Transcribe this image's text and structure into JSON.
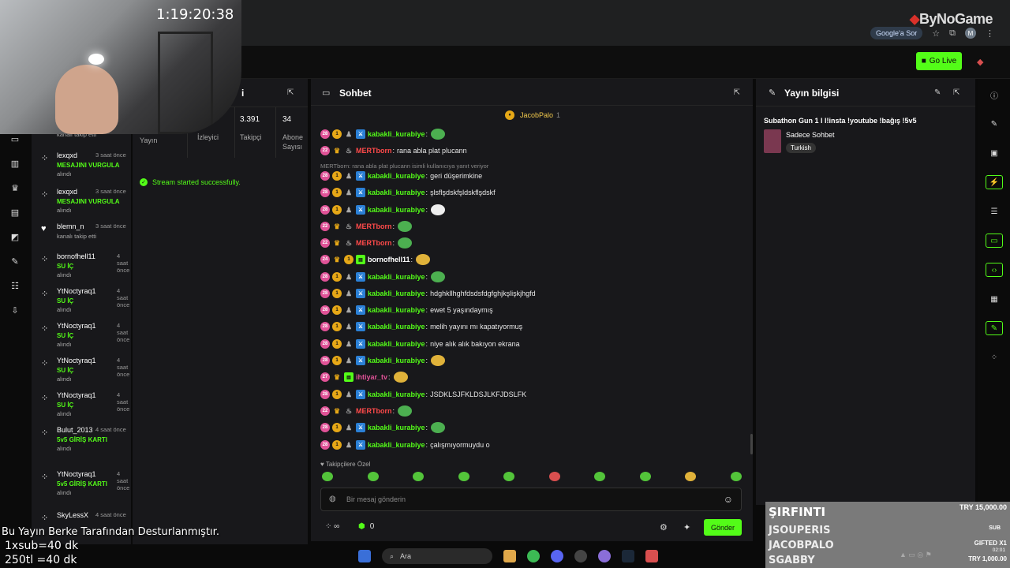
{
  "overlay": {
    "timer": "1:19:20:38",
    "brand": "ByNoGame",
    "footer_line1": "Bu Yayın Berke Tarafından Desturlanmıştır.",
    "footer_line2": "1xsub=40 dk",
    "footer_line3": "250tl =40 dk"
  },
  "browser": {
    "google_sor": "Google'a Sor",
    "avatar_letter": "M"
  },
  "header": {
    "go_live": "Go Live"
  },
  "feed": {
    "items": [
      {
        "name": "",
        "time": "",
        "action": "",
        "sub": "kanalı takip etti"
      },
      {
        "name": "lexqxd",
        "time": "3 saat önce",
        "action": "MESAJINI VURGULA",
        "sub": "alındı"
      },
      {
        "name": "lexqxd",
        "time": "3 saat önce",
        "action": "MESAJINI VURGULA",
        "sub": "alındı"
      },
      {
        "name": "blemn_n",
        "time": "3 saat önce",
        "action": "",
        "sub": "kanalı takip etti"
      },
      {
        "name": "bornofhell11",
        "time": "4 saat önce",
        "action": "SU İÇ",
        "sub": "alındı"
      },
      {
        "name": "YtNoctyraq1",
        "time": "4 saat önce",
        "action": "SU İÇ",
        "sub": "alındı"
      },
      {
        "name": "YtNoctyraq1",
        "time": "4 saat önce",
        "action": "SU İÇ",
        "sub": "alındı"
      },
      {
        "name": "YtNoctyraq1",
        "time": "4 saat önce",
        "action": "SU İÇ",
        "sub": "alındı"
      },
      {
        "name": "YtNoctyraq1",
        "time": "4 saat önce",
        "action": "SU İÇ",
        "sub": "alındı"
      },
      {
        "name": "Bulut_2013",
        "time": "4 saat önce",
        "action": "5v5 GİRİŞ KARTI",
        "sub": "alındı"
      },
      {
        "name": "YtNoctyraq1",
        "time": "4 saat önce",
        "action": "5v5 GİRİŞ KARTI",
        "sub": "alındı"
      },
      {
        "name": "SkyLessX",
        "time": "4 saat önce",
        "action": "",
        "sub": ""
      }
    ]
  },
  "stats": {
    "title": "i",
    "yayin_label": "Yayın",
    "izleyici_label": "İzleyici",
    "takipci_value": "3.391",
    "takipci_label": "Takipçi",
    "abone_value": "34",
    "abone_label": "Abone Sayısı",
    "success": "Stream started successfully."
  },
  "chat": {
    "title": "Sohbet",
    "pinned_user": "JacobPalo",
    "pinned_count": "1",
    "reply_text": "MERTborn: rana abla plat plucann isimli kullanıcıya yanıt veriyor",
    "followers_only": "Takipçilere Özel",
    "placeholder": "Bir mesaj gönderin",
    "count_zero": "0",
    "send_label": "Gönder",
    "messages": [
      {
        "badge": "28",
        "user": "kabakli_kurabiye",
        "text": "",
        "emote": "green"
      },
      {
        "badge": "22",
        "user": "MERTborn",
        "text": "rana abla plat plucann",
        "emote": ""
      },
      {
        "badge": "28",
        "user": "kabakli_kurabiye",
        "text": "geri düşerimkine",
        "emote": ""
      },
      {
        "badge": "28",
        "user": "kabakli_kurabiye",
        "text": "şlsflşdskfşldskflşdskf",
        "emote": ""
      },
      {
        "badge": "28",
        "user": "kabakli_kurabiye",
        "text": "",
        "emote": "white"
      },
      {
        "badge": "22",
        "user": "MERTborn",
        "text": "",
        "emote": "green"
      },
      {
        "badge": "22",
        "user": "MERTborn",
        "text": "",
        "emote": "green"
      },
      {
        "badge": "24",
        "user": "bornofhell11",
        "text": "",
        "emote": "yellow"
      },
      {
        "badge": "28",
        "user": "kabakli_kurabiye",
        "text": "",
        "emote": "green"
      },
      {
        "badge": "28",
        "user": "kabakli_kurabiye",
        "text": "hdghkllhghfdsdsfdgfghjkşlişkjhgfd",
        "emote": ""
      },
      {
        "badge": "28",
        "user": "kabakli_kurabiye",
        "text": "ewet 5 yaşındaymış",
        "emote": ""
      },
      {
        "badge": "28",
        "user": "kabakli_kurabiye",
        "text": "melih yayını mı kapatıyormuş",
        "emote": ""
      },
      {
        "badge": "28",
        "user": "kabakli_kurabiye",
        "text": "niye alık alık bakıyon ekrana",
        "emote": ""
      },
      {
        "badge": "28",
        "user": "kabakli_kurabiye",
        "text": "",
        "emote": "yellow"
      },
      {
        "badge": "27",
        "user": "ihtiyar_tv",
        "text": "",
        "emote": "yellow"
      },
      {
        "badge": "28",
        "user": "kabakli_kurabiye",
        "text": "JSDKLSJFKLDSJLKFJDSLFK",
        "emote": ""
      },
      {
        "badge": "22",
        "user": "MERTborn",
        "text": "",
        "emote": "green"
      },
      {
        "badge": "28",
        "user": "kabakli_kurabiye",
        "text": "",
        "emote": "green"
      },
      {
        "badge": "28",
        "user": "kabakli_kurabiye",
        "text": "çalışmıyormuydu o",
        "emote": ""
      }
    ]
  },
  "info": {
    "title": "Yayın bilgisi",
    "stream_title": "Subathon Gun 1 l l!insta !youtube !bağış !5v5",
    "category": "Sadece Sohbet",
    "language": "Turkish"
  },
  "donations": {
    "top_name": "ŞIRFINTI",
    "top_amount": "TRY 15,000.00",
    "row2": "JSOUPERIS",
    "row2_tag": "SUB",
    "row3": "JACOBPALO",
    "row3_tag": "GIFTED X1",
    "row3_time": "02:01",
    "row4": "SGABBY",
    "row4_amount": "TRY 1,000.00"
  },
  "taskbar": {
    "search": "Ara"
  }
}
